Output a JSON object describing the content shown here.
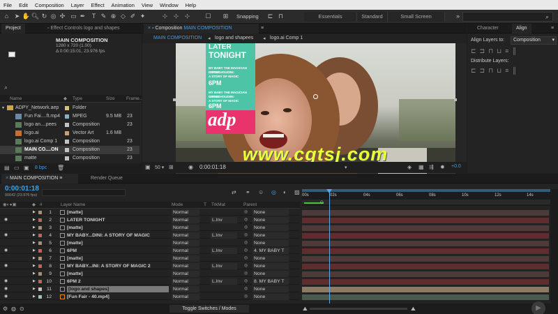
{
  "menu": [
    "File",
    "Edit",
    "Composition",
    "Layer",
    "Effect",
    "Animation",
    "View",
    "Window",
    "Help"
  ],
  "toolbar": {
    "snapping": "Snapping",
    "workspaces": [
      "Essentials",
      "Standard",
      "Small Screen"
    ]
  },
  "project_panel": {
    "tabs": [
      "Project",
      "Effect Controls logo and shapes"
    ],
    "comp_name": "MAIN COMPOSITION",
    "comp_info_1": "1280 x 720 (1.00)",
    "comp_info_2": "Δ 0:00:15:01, 23.976 fps",
    "headers": {
      "name": "Name",
      "type": "Type",
      "size": "Size",
      "frame": "Frame..."
    },
    "items": [
      {
        "name": "ADPY_Network.aep",
        "type": "Folder",
        "size": "",
        "extra": "",
        "color": "#d9c27a",
        "icon": "folder-icon"
      },
      {
        "name": "Fun Fai....ft.mp4",
        "type": "MPEG",
        "size": "9.5 MB",
        "extra": "23",
        "color": "#8ab0c8",
        "icon": "video-icon"
      },
      {
        "name": "logo an....pees",
        "type": "Composition",
        "size": "",
        "extra": "23",
        "color": "#c3c3c3",
        "icon": "comp-icon"
      },
      {
        "name": "logo.ai",
        "type": "Vector Art",
        "size": "1.6 MB",
        "extra": "",
        "color": "#c9a078",
        "icon": "vector-icon"
      },
      {
        "name": "logo.ai Comp 1",
        "type": "Composition",
        "size": "",
        "extra": "23",
        "color": "#c3c3c3",
        "icon": "comp-icon"
      },
      {
        "name": "MAIN CO....ON",
        "type": "Composition",
        "size": "",
        "extra": "23",
        "color": "#c3c3c3",
        "icon": "comp-icon"
      },
      {
        "name": "matte",
        "type": "Composition",
        "size": "",
        "extra": "23",
        "color": "#c3c3c3",
        "icon": "comp-icon"
      }
    ],
    "bpc": "8 bpc"
  },
  "composition_panel": {
    "tab_prefix": "Composition",
    "tab_name": "MAIN COMPOSITION",
    "breadcrumbs": [
      "MAIN COMPOSITION",
      "logo and shapees",
      "logo.ai Comp 1"
    ],
    "overlay": {
      "later": "LATER",
      "tonight": "TONIGHT",
      "line1": "MY BABY THE MAGICIAN SERIES",
      "line2": "LITTLE HOUDINI:",
      "line3": "A STORY OF MAGIC",
      "time1": "6PM",
      "line4": "MY BABY THE MAGICIAN SERIES",
      "line5": "LITTLE HOUDINI:",
      "line6": "A STORY OF MAGIC",
      "time2": "6PM",
      "logo": "adp"
    },
    "watermark": "www.cgtsj.com",
    "footer_zoom": "50",
    "footer_time": "0:00:01:18",
    "footer_value": "+0.0"
  },
  "right_panel": {
    "tabs": [
      "Character",
      "Align"
    ],
    "align_label": "Align Layers to:",
    "align_value": "Composition",
    "distribute_label": "Distribute Layers:"
  },
  "timeline": {
    "tabs": [
      "MAIN COMPOSITION",
      "Render Queue"
    ],
    "timecode": "0:00:01:18",
    "frame_info": "00042 (23.976 fps)",
    "headers": {
      "layer_name": "Layer Name",
      "mode": "Mode",
      "t": "T",
      "trkmat": "TrkMat",
      "parent": "Parent"
    },
    "ruler": [
      "00s",
      "02s",
      "04s",
      "06s",
      "08s",
      "10s",
      "12s",
      "14s"
    ],
    "layers": [
      {
        "num": "1",
        "name": "[matte]",
        "mode": "Normal",
        "trk": "",
        "parent": "None",
        "color": "#a88f7a",
        "bar": "#5a3a3a"
      },
      {
        "num": "2",
        "name": "LATER TONIGHT",
        "mode": "Normal",
        "trk": "L.Inv",
        "parent": "None",
        "color": "#c46060",
        "bar": "#6d2b2b"
      },
      {
        "num": "3",
        "name": "[matte]",
        "mode": "Normal",
        "trk": "",
        "parent": "None",
        "color": "#a88f7a",
        "bar": "#5a3a3a"
      },
      {
        "num": "4",
        "name": "MY BABY...DINI: A STORY OF MAGIC",
        "mode": "Normal",
        "trk": "L.Inv",
        "parent": "None",
        "color": "#c46060",
        "bar": "#6d2b2b"
      },
      {
        "num": "5",
        "name": "[matte]",
        "mode": "Normal",
        "trk": "",
        "parent": "None",
        "color": "#a88f7a",
        "bar": "#5a3a3a"
      },
      {
        "num": "6",
        "name": "6PM",
        "mode": "Normal",
        "trk": "L.Inv",
        "parent": "4. MY BABY T",
        "color": "#c46060",
        "bar": "#6d2b2b"
      },
      {
        "num": "7",
        "name": "[matte]",
        "mode": "Normal",
        "trk": "",
        "parent": "None",
        "color": "#a88f7a",
        "bar": "#5a3a3a"
      },
      {
        "num": "8",
        "name": "MY BABY...INI: A STORY OF MAGIC 2",
        "mode": "Normal",
        "trk": "L.Inv",
        "parent": "None",
        "color": "#c46060",
        "bar": "#6d2b2b"
      },
      {
        "num": "9",
        "name": "[matte]",
        "mode": "Normal",
        "trk": "",
        "parent": "None",
        "color": "#a88f7a",
        "bar": "#5a3a3a"
      },
      {
        "num": "10",
        "name": "6PM 2",
        "mode": "Normal",
        "trk": "L.Inv",
        "parent": "8. MY BABY T",
        "color": "#c46060",
        "bar": "#6d2b2b"
      },
      {
        "num": "11",
        "name": "[logo and shapes]",
        "mode": "Normal",
        "trk": "",
        "parent": "None",
        "color": "#c3c3c3",
        "bar": "#7d6e5c"
      },
      {
        "num": "12",
        "name": "[Fun Fair - 40.mp4]",
        "mode": "Normal",
        "trk": "",
        "parent": "None",
        "color": "#9fc3b0",
        "bar": "#4d5e52"
      }
    ],
    "toggle_label": "Toggle Switches / Modes"
  },
  "colors": {
    "accent_blue": "#2d8ceb",
    "timecode": "#3ea3e8",
    "teal": "#4dc4a6",
    "pink": "#e8336d",
    "indicator": "#58a6e6"
  }
}
